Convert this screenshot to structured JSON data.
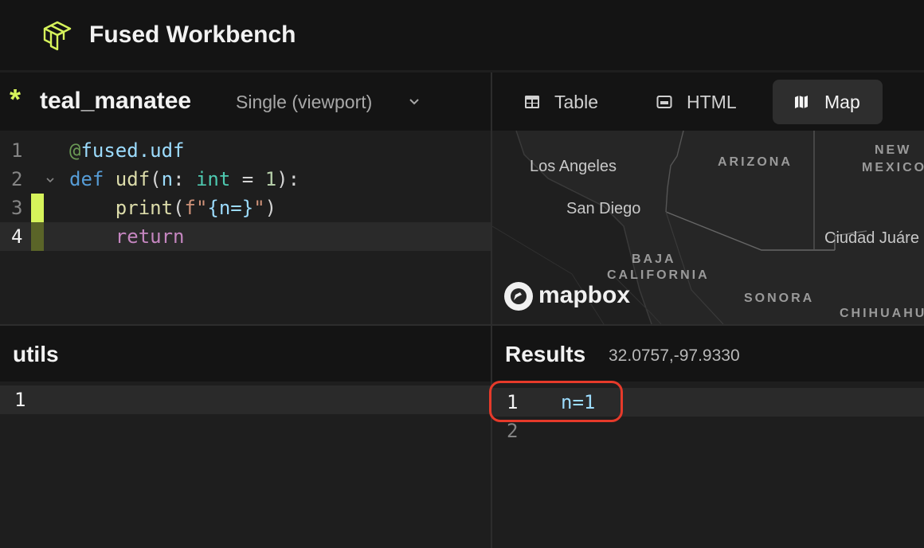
{
  "app": {
    "title": "Fused Workbench",
    "logo_icon": "fused-logo-icon",
    "accent": "#d6f35b"
  },
  "udf": {
    "modified_marker": "*",
    "name": "teal_manatee",
    "mode": "Single (viewport)",
    "code": {
      "line_numbers": [
        "1",
        "2",
        "3",
        "4"
      ],
      "lines": [
        {
          "tokens": [
            "@",
            "fused",
            ".",
            "udf"
          ]
        },
        {
          "tokens": [
            "def ",
            "udf",
            "(",
            "n",
            ": ",
            "int",
            " = ",
            "1",
            "):"
          ]
        },
        {
          "tokens": [
            "    ",
            "print",
            "(",
            "f\"",
            "{n=}",
            "\"",
            ")"
          ]
        },
        {
          "tokens": [
            "    ",
            "return"
          ]
        }
      ]
    }
  },
  "utils": {
    "title": "utils",
    "line_numbers": [
      "1"
    ]
  },
  "tabs": [
    {
      "label": "Table",
      "icon": "table-icon"
    },
    {
      "label": "HTML",
      "icon": "html-icon"
    },
    {
      "label": "Map",
      "icon": "map-icon",
      "active": true
    }
  ],
  "map": {
    "labels": {
      "los_angeles": "Los Angeles",
      "san_diego": "San Diego",
      "ciudad_juarez": "Ciudad Juáre"
    },
    "regions": {
      "arizona": "ARIZONA",
      "new_mexico_1": "NEW",
      "new_mexico_2": "MEXICO",
      "baja_1": "BAJA",
      "baja_2": "CALIFORNIA",
      "sonora": "SONORA",
      "chihuahua": "CHIHUAHU"
    },
    "attribution": "mapbox"
  },
  "results": {
    "title": "Results",
    "coordinates": "32.0757,-97.9330",
    "line_numbers": [
      "1",
      "2"
    ],
    "output": [
      "n=1",
      ""
    ],
    "highlight_color": "#e63a2a"
  }
}
